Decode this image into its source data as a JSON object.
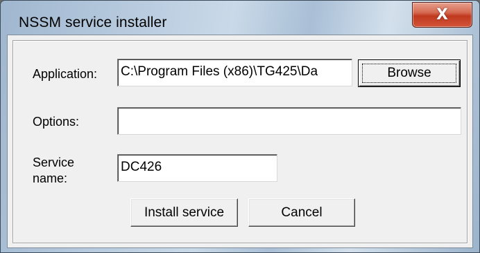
{
  "window": {
    "title": "NSSM service installer",
    "close_glyph": "X"
  },
  "form": {
    "application_label": "Application:",
    "application_value": "C:\\Program Files (x86)\\TG425\\Da",
    "browse_label": "Browse",
    "options_label": "Options:",
    "options_value": "",
    "service_name_label_line1": "Service",
    "service_name_label_line2": "name:",
    "service_name_value": "DC426"
  },
  "actions": {
    "install_label": "Install service",
    "cancel_label": "Cancel"
  },
  "colors": {
    "close_button": "#c0391f",
    "client_bg": "#f0f0f0"
  }
}
